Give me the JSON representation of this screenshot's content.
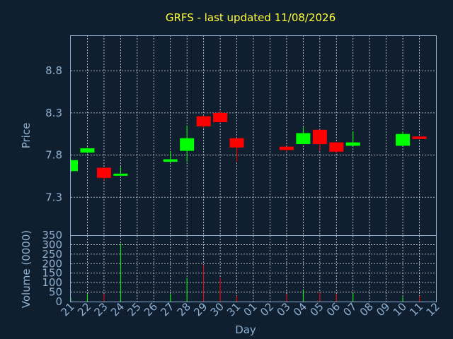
{
  "chart_data": {
    "type": "candlestick",
    "title": "GRFS - last updated 11/08/2026",
    "xlabel": "Day",
    "up_color": "#00ff00",
    "down_color": "#ff0000",
    "x_ticks": [
      "21",
      "22",
      "23",
      "24",
      "25",
      "26",
      "27",
      "28",
      "29",
      "30",
      "31",
      "01",
      "02",
      "03",
      "04",
      "05",
      "06",
      "07",
      "08",
      "09",
      "10",
      "11",
      "12"
    ],
    "price_panel": {
      "ylabel": "Price",
      "y_ticks": [
        "7.3",
        "7.8",
        "8.3",
        "8.8"
      ],
      "ylim": [
        6.85,
        9.22
      ]
    },
    "volume_panel": {
      "ylabel": "Volume (0000)",
      "y_ticks": [
        "0",
        "50",
        "100",
        "150",
        "200",
        "250",
        "300",
        "350"
      ],
      "ylim": [
        0,
        350
      ]
    },
    "candles": [
      {
        "day": "21",
        "open": 7.61,
        "close": 7.74,
        "high": 7.75,
        "low": 7.6,
        "volume": 20
      },
      {
        "day": "22",
        "open": 7.83,
        "close": 7.88,
        "high": 7.89,
        "low": 7.82,
        "volume": 40
      },
      {
        "day": "23",
        "open": 7.65,
        "close": 7.53,
        "high": 7.65,
        "low": 7.5,
        "volume": 40
      },
      {
        "day": "24",
        "open": 7.56,
        "close": 7.58,
        "high": 7.66,
        "low": 7.56,
        "volume": 305
      },
      {
        "day": "27",
        "open": 7.72,
        "close": 7.75,
        "high": 7.85,
        "low": 7.71,
        "volume": 40
      },
      {
        "day": "28",
        "open": 7.85,
        "close": 8.0,
        "high": 8.15,
        "low": 7.72,
        "volume": 125
      },
      {
        "day": "29",
        "open": 8.26,
        "close": 8.14,
        "high": 8.27,
        "low": 8.12,
        "volume": 195
      },
      {
        "day": "30",
        "open": 8.3,
        "close": 8.19,
        "high": 8.33,
        "low": 8.18,
        "volume": 125
      },
      {
        "day": "31",
        "open": 8.0,
        "close": 7.89,
        "high": 8.0,
        "low": 7.72,
        "volume": 30
      },
      {
        "day": "03",
        "open": 7.9,
        "close": 7.86,
        "high": 7.9,
        "low": 7.84,
        "volume": 40
      },
      {
        "day": "04",
        "open": 7.93,
        "close": 8.06,
        "high": 8.13,
        "low": 7.93,
        "volume": 65
      },
      {
        "day": "05",
        "open": 8.1,
        "close": 7.93,
        "high": 8.1,
        "low": 7.85,
        "volume": 50
      },
      {
        "day": "06",
        "open": 7.95,
        "close": 7.84,
        "high": 7.95,
        "low": 7.82,
        "volume": 40
      },
      {
        "day": "07",
        "open": 7.91,
        "close": 7.95,
        "high": 8.08,
        "low": 7.91,
        "volume": 45
      },
      {
        "day": "10",
        "open": 7.91,
        "close": 8.05,
        "high": 8.08,
        "low": 7.91,
        "volume": 25
      },
      {
        "day": "11",
        "open": 8.02,
        "close": 7.99,
        "high": 8.02,
        "low": 7.99,
        "volume": 30
      }
    ]
  }
}
